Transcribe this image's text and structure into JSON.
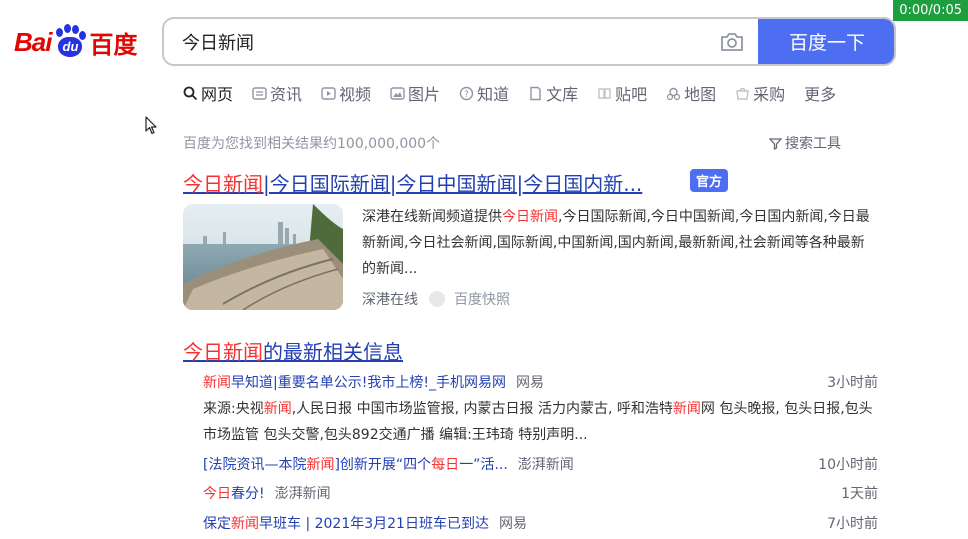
{
  "timer": "0:00/0:05",
  "logo": {
    "latin": "Bai",
    "paw_text": "du",
    "cn": "百度"
  },
  "search": {
    "query": "今日新闻",
    "button": "百度一下"
  },
  "tabs": [
    "网页",
    "资讯",
    "视频",
    "图片",
    "知道",
    "文库",
    "贴吧",
    "地图",
    "采购",
    "更多"
  ],
  "stats": "百度为您找到相关结果约100,000,000个",
  "tools": "搜索工具",
  "result1": {
    "title_hl": "今日新闻",
    "title_rest": "|今日国际新闻|今日中国新闻|今日国内新...",
    "badge": "官方",
    "abs_a": "深港在线新闻频道提供",
    "abs_hl": "今日新闻",
    "abs_b": ",今日国际新闻,今日中国新闻,今日国内新闻,今日最新新闻,今日社会新闻,国际新闻,中国新闻,国内新闻,最新新闻,社会新闻等各种最新的新闻...",
    "source": "深港在线",
    "snapshot": "百度快照"
  },
  "result2": {
    "title_hl": "今日新闻",
    "title_rest": "的最新相关信息",
    "items": [
      {
        "hl": "新闻",
        "title": "早知道|重要名单公示!我市上榜!_手机网易网",
        "source": "网易",
        "time": "3小时前"
      },
      {
        "pre": "[法院资讯—本院",
        "hl": "新闻",
        "mid": "]创新开展“四个",
        "hl2": "每日",
        "post": "一”活...",
        "source": "澎湃新闻",
        "time": "10小时前"
      },
      {
        "hl": "今日",
        "title": "春分!",
        "source": "澎湃新闻",
        "time": "1天前"
      },
      {
        "pre": "保定",
        "hl": "新闻",
        "title": "早班车 | 2021年3月21日班车已到达",
        "source": "网易",
        "time": "7小时前"
      }
    ],
    "abs_a": "来源:央视",
    "abs_hl1": "新闻",
    "abs_b": ",人民日报 中国市场监管报, 内蒙古日报 活力内蒙古, 呼和浩特",
    "abs_hl2": "新闻",
    "abs_c": "网 包头晚报, 包头日报,包头市场监管 包头交警,包头892交通广播 编辑:王玮琦 特别声明..."
  }
}
